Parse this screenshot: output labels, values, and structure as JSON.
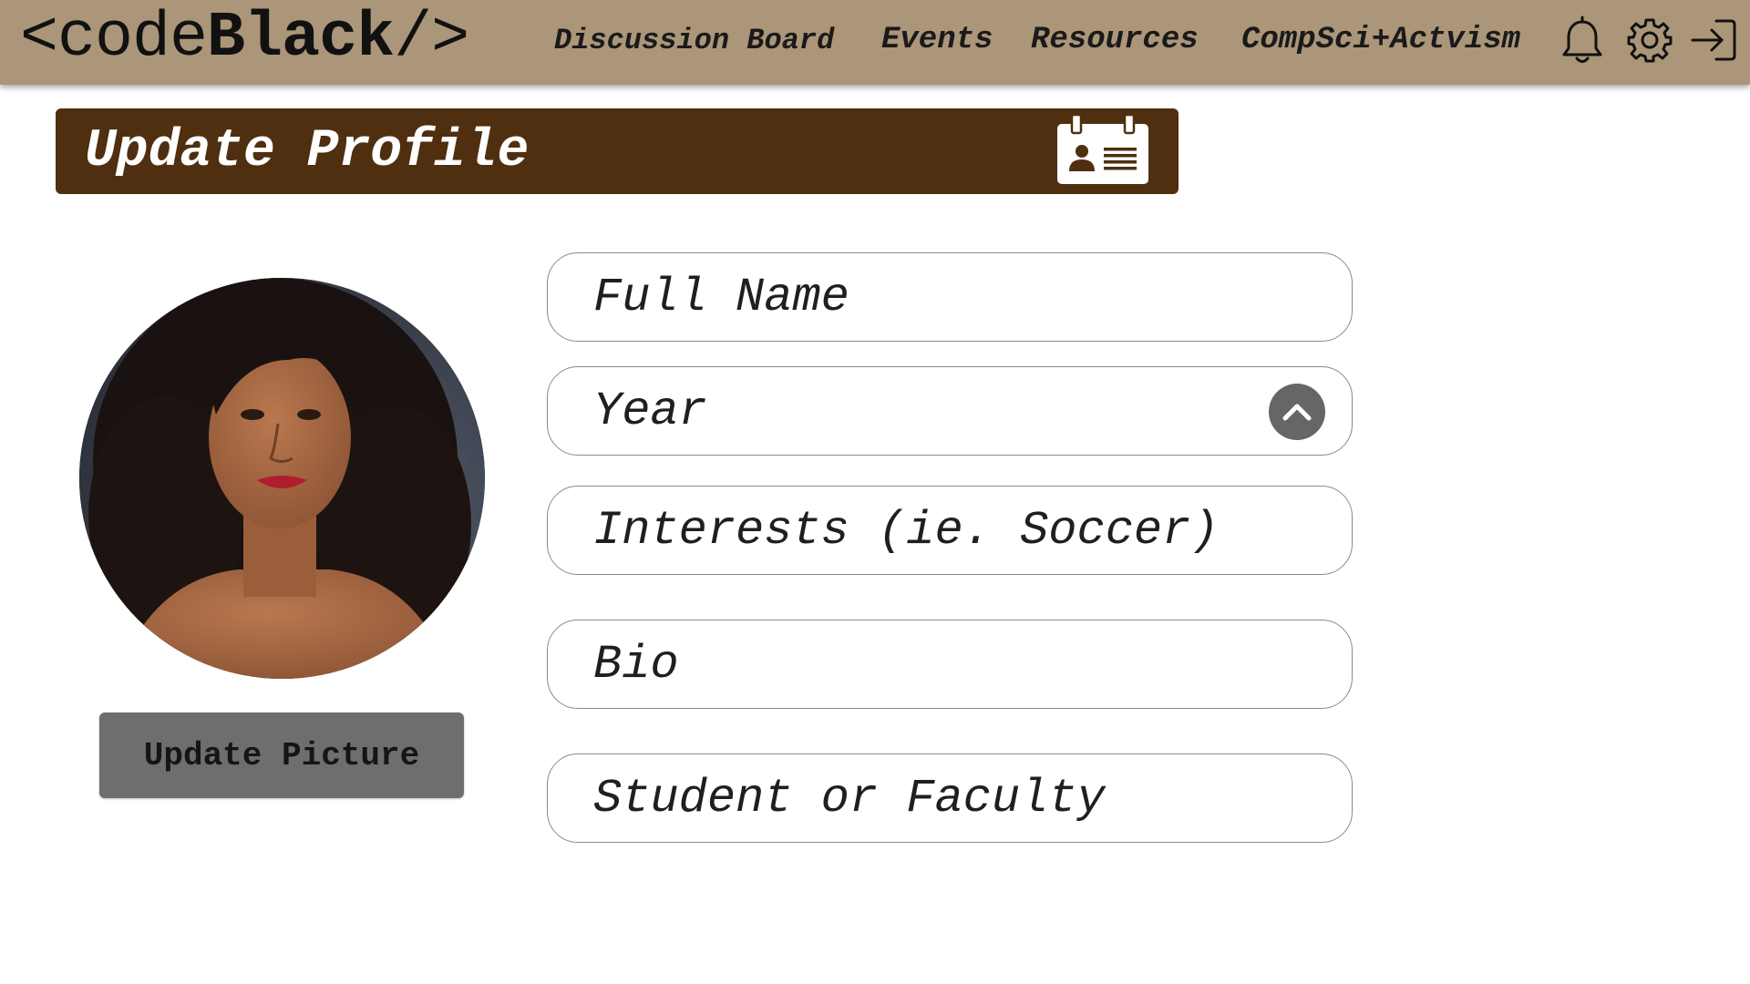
{
  "app": {
    "logo_prefix": "<code",
    "logo_bold": "Black",
    "logo_suffix": "/>"
  },
  "nav": {
    "items": [
      {
        "label": "Discussion Board"
      },
      {
        "label": "Events"
      },
      {
        "label": "Resources"
      },
      {
        "label": "CompSci+Actvism"
      }
    ],
    "icons": [
      "bell-icon",
      "gear-icon",
      "logout-icon"
    ]
  },
  "header": {
    "title": "Update Profile",
    "icon": "id-badge-icon"
  },
  "profile": {
    "update_picture_label": "Update Picture"
  },
  "form": {
    "full_name": {
      "placeholder": "Full Name",
      "value": ""
    },
    "year": {
      "placeholder": "Year",
      "value": ""
    },
    "interests": {
      "placeholder": "Interests (ie. Soccer)",
      "value": ""
    },
    "bio": {
      "placeholder": "Bio",
      "value": ""
    },
    "role": {
      "placeholder": "Student or Faculty",
      "value": ""
    }
  },
  "colors": {
    "topbar": "#ab9679",
    "banner": "#4f2f0f",
    "button": "#6e6e6e",
    "chevron": "#666666"
  }
}
